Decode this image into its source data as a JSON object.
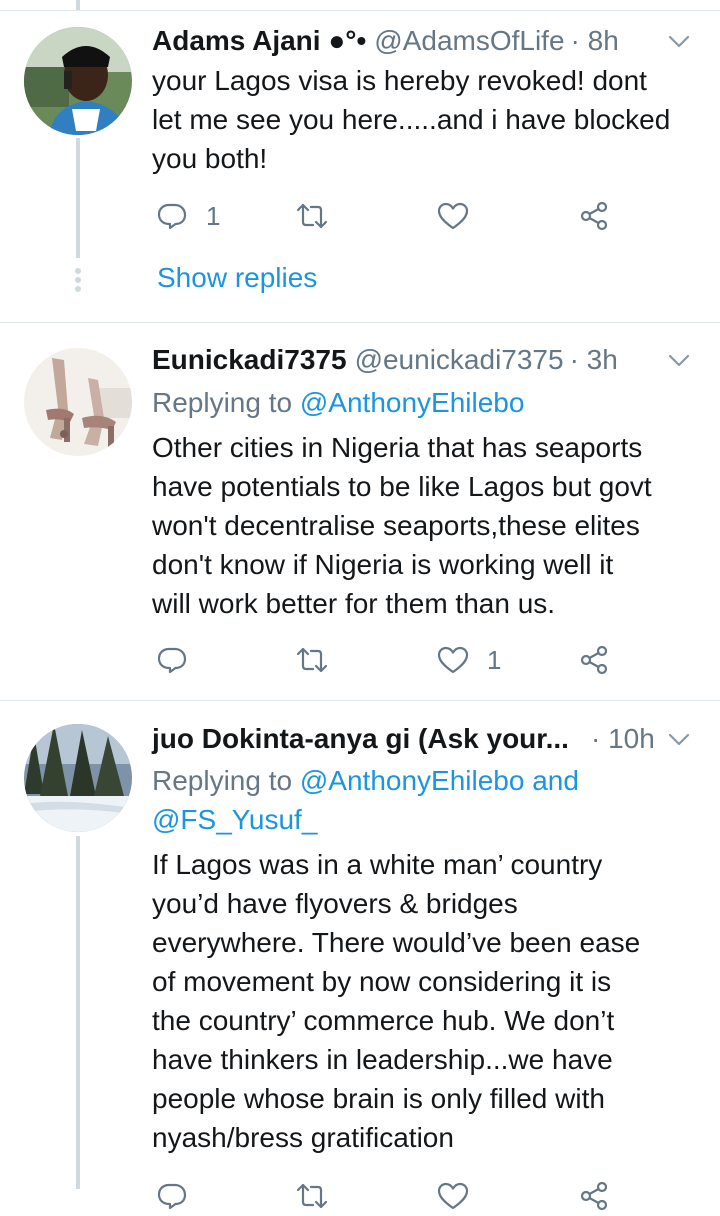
{
  "tweets": [
    {
      "name": "Adams Ajani ●°•",
      "handle": "@AdamsOfLife",
      "time": "· 8h",
      "replying_prefix": "",
      "replying_to": "",
      "text_lines": [
        "your Lagos visa is hereby revoked! dont",
        "let me see you here.....and i have blocked",
        "you both!"
      ],
      "reply_count": "1",
      "retweet_count": "",
      "like_count": "",
      "show_replies": "Show replies"
    },
    {
      "name": "Eunickadi7375",
      "handle": "@eunickadi7375",
      "time": "· 3h",
      "replying_prefix": "Replying to",
      "replying_to": "@AnthonyEhilebo",
      "text_lines": [
        "Other cities in Nigeria that has seaports",
        "have potentials to be like Lagos but govt",
        "won't decentralise seaports,these elites",
        "don't know if Nigeria is working well it",
        "will work better for them than us."
      ],
      "reply_count": "",
      "retweet_count": "",
      "like_count": "1"
    },
    {
      "name": "juo Dokinta-anya gi (Ask your...",
      "handle": "",
      "time": "· 10h",
      "replying_prefix": "Replying to",
      "replying_to_line1": "@AnthonyEhilebo and",
      "replying_to_line2": "@FS_Yusuf_",
      "text_lines": [
        "If Lagos was in a white man’ country",
        "you’d have flyovers & bridges",
        "everywhere. There would’ve been ease",
        "of movement by now considering it is",
        "the country’ commerce hub. We don’t",
        "have thinkers in leadership...we have",
        "people whose brain is only filled with",
        "nyash/bress gratification"
      ]
    }
  ],
  "icons": {
    "reply": "reply-icon",
    "retweet": "retweet-icon",
    "like": "like-icon",
    "share": "share-icon",
    "more": "chevron-down-icon"
  },
  "colors": {
    "link": "#1b95e0",
    "muted": "#657786",
    "thread_line": "#cfd9de",
    "divider": "#e1e8ed"
  }
}
